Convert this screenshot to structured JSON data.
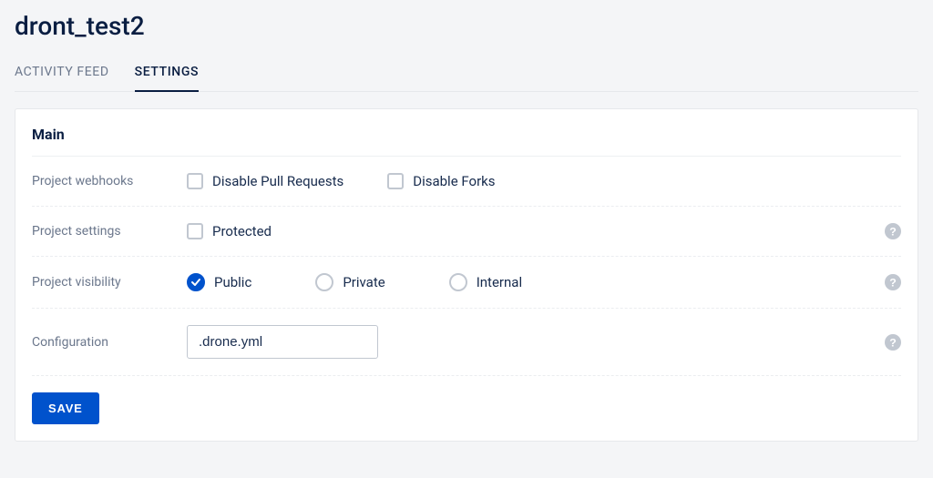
{
  "title": "dront_test2",
  "tabs": {
    "activity": "Activity Feed",
    "settings": "Settings"
  },
  "section": {
    "heading": "Main",
    "webhooks": {
      "label": "Project webhooks",
      "disable_pr": "Disable Pull Requests",
      "disable_forks": "Disable Forks"
    },
    "settings": {
      "label": "Project settings",
      "protected": "Protected"
    },
    "visibility": {
      "label": "Project visibility",
      "public": "Public",
      "private": "Private",
      "internal": "Internal",
      "selected": "public"
    },
    "configuration": {
      "label": "Configuration",
      "value": ".drone.yml"
    },
    "save": "Save"
  }
}
